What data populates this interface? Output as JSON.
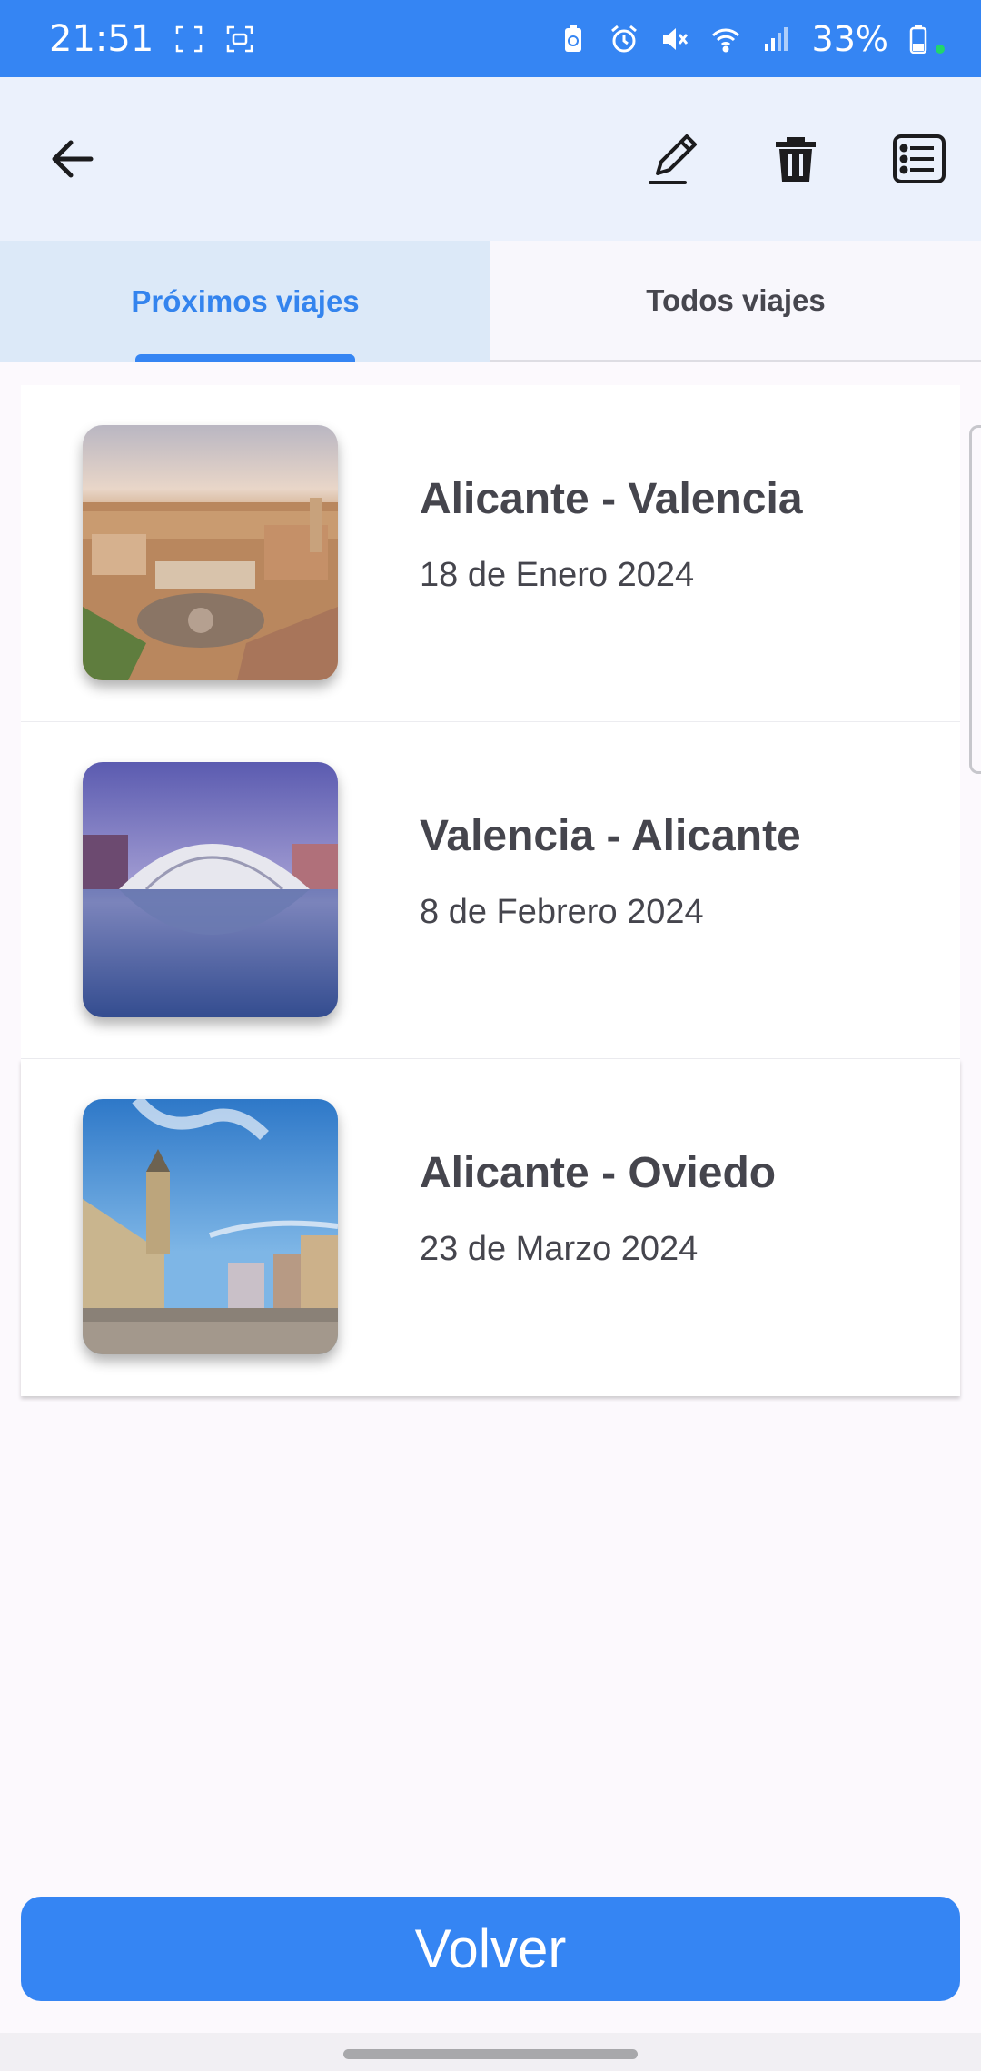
{
  "status_bar": {
    "time": "21:51",
    "battery": "33%",
    "icons": [
      "screenshot-icon",
      "screen-record-icon",
      "battery-saver-icon",
      "alarm-icon",
      "mute-icon",
      "wifi-icon",
      "signal-icon",
      "battery-icon"
    ]
  },
  "app_bar": {
    "icons": [
      "arrow-back-icon",
      "edit-icon",
      "delete-icon",
      "list-icon"
    ]
  },
  "tabs": [
    {
      "label": "Próximos viajes",
      "active": true
    },
    {
      "label": "Todos viajes",
      "active": false
    }
  ],
  "trips": [
    {
      "title": "Alicante - Valencia",
      "date": "18 de Enero 2024"
    },
    {
      "title": "Valencia - Alicante",
      "date": "8 de Febrero 2024"
    },
    {
      "title": "Alicante - Oviedo",
      "date": "23 de Marzo 2024"
    }
  ],
  "volver_label": "Volver",
  "colors": {
    "primary": "#3585f3",
    "app_bar_bg": "#ebf1fc",
    "tab_active_bg": "#dce9f8",
    "text": "#45454d"
  }
}
